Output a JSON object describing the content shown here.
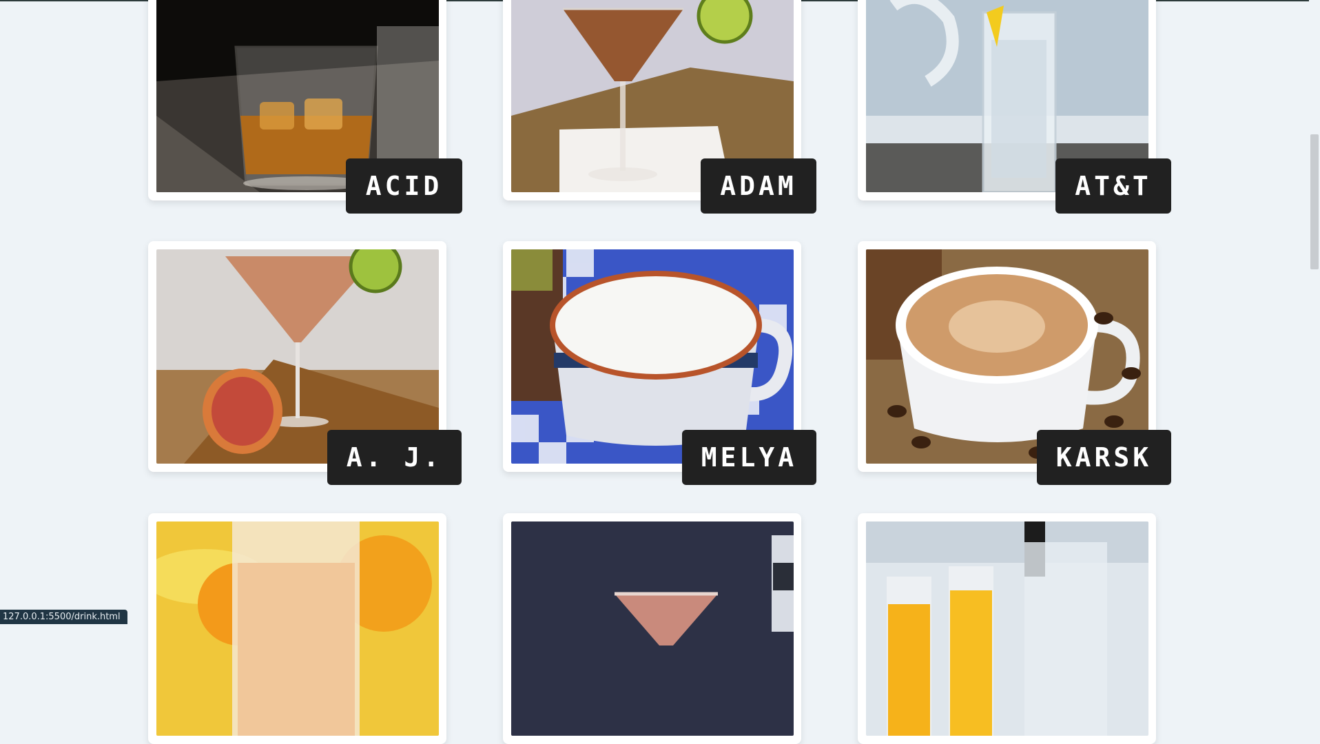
{
  "drinks": [
    {
      "name": "ACID",
      "image_icon": "whiskey-rocks-glass-icon"
    },
    {
      "name": "ADAM",
      "image_icon": "martini-glass-lime-icon"
    },
    {
      "name": "AT&T",
      "image_icon": "highball-glass-lemon-icon"
    },
    {
      "name": "A. J.",
      "image_icon": "martini-grapefruit-icon"
    },
    {
      "name": "MELYA",
      "image_icon": "foamy-coffee-mug-icon"
    },
    {
      "name": "KARSK",
      "image_icon": "latte-cup-beans-icon"
    },
    {
      "name": "",
      "image_icon": "juice-glass-fruit-icon"
    },
    {
      "name": "",
      "image_icon": "pink-cocktail-bottle-icon"
    },
    {
      "name": "",
      "image_icon": "orange-drinks-ice-bucket-icon"
    }
  ],
  "status_bar": {
    "url": "127.0.0.1:5500/drink.html"
  },
  "colors": {
    "background": "#eef3f7",
    "label_bg": "#212121",
    "card": "#ffffff"
  }
}
